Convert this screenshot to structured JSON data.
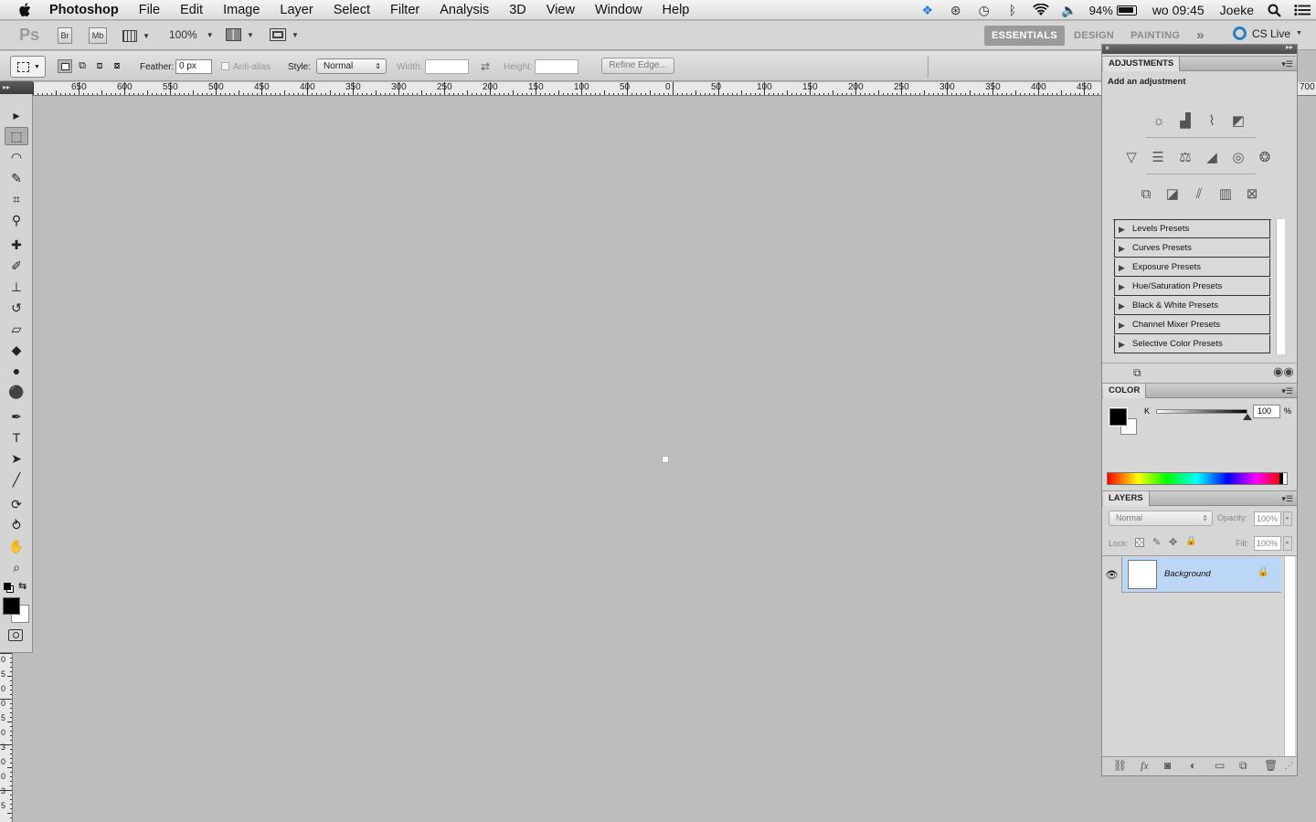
{
  "menubar": {
    "app_name": "Photoshop",
    "menus": [
      "File",
      "Edit",
      "Image",
      "Layer",
      "Select",
      "Filter",
      "Analysis",
      "3D",
      "View",
      "Window",
      "Help"
    ],
    "battery": "94%",
    "clock": "wo 09:45",
    "user": "Joeke"
  },
  "appbar": {
    "ps_logo": "Ps",
    "bridge": "Br",
    "mini_bridge": "Mb",
    "zoom": "100%",
    "workspaces": [
      "ESSENTIALS",
      "DESIGN",
      "PAINTING"
    ],
    "active_workspace": "ESSENTIALS",
    "more": "»",
    "cs_live": "CS Live"
  },
  "options": {
    "feather_label": "Feather:",
    "feather_value": "0 px",
    "antialias_label": "Anti-alias",
    "style_label": "Style:",
    "style_value": "Normal",
    "width_label": "Width:",
    "height_label": "Height:",
    "refine_edge": "Refine Edge..."
  },
  "rulers": {
    "h_ticks": [
      "650",
      "600",
      "550",
      "500",
      "450",
      "400",
      "350",
      "300",
      "250",
      "200",
      "150",
      "100",
      "50",
      "0",
      "50",
      "100",
      "150",
      "200",
      "250",
      "300",
      "350",
      "400",
      "450"
    ],
    "h_right": "700",
    "v_ticks": [
      "0",
      "5",
      "0",
      "0",
      "5",
      "0",
      "3",
      "0",
      "0",
      "3",
      "5"
    ]
  },
  "toolbox": {
    "tools": [
      {
        "name": "move",
        "glyph": "▸"
      },
      {
        "name": "marquee",
        "glyph": "⬚"
      },
      {
        "name": "lasso",
        "glyph": "◠"
      },
      {
        "name": "quick-select",
        "glyph": "✎"
      },
      {
        "name": "crop",
        "glyph": "⌗"
      },
      {
        "name": "eyedropper",
        "glyph": "⚲"
      },
      {
        "name": "healing",
        "glyph": "✚"
      },
      {
        "name": "brush",
        "glyph": "✐"
      },
      {
        "name": "stamp",
        "glyph": "⊥"
      },
      {
        "name": "history-brush",
        "glyph": "↺"
      },
      {
        "name": "eraser",
        "glyph": "▱"
      },
      {
        "name": "paint-bucket",
        "glyph": "◆"
      },
      {
        "name": "blur",
        "glyph": "●"
      },
      {
        "name": "dodge",
        "glyph": "⚫"
      },
      {
        "name": "pen",
        "glyph": "✒"
      },
      {
        "name": "type",
        "glyph": "T"
      },
      {
        "name": "path-select",
        "glyph": "➤"
      },
      {
        "name": "line",
        "glyph": "╱"
      },
      {
        "name": "3d-rotate",
        "glyph": "⟳"
      },
      {
        "name": "3d-orbit",
        "glyph": "⥁"
      },
      {
        "name": "hand",
        "glyph": "✋"
      },
      {
        "name": "zoom",
        "glyph": "⌕"
      }
    ],
    "selected_tool": "marquee",
    "foreground_color": "#000000",
    "background_color": "#ffffff"
  },
  "adjustments": {
    "title": "ADJUSTMENTS",
    "subtitle": "Add an adjustment",
    "presets": [
      "Levels Presets",
      "Curves Presets",
      "Exposure Presets",
      "Hue/Saturation Presets",
      "Black & White Presets",
      "Channel Mixer Presets",
      "Selective Color Presets"
    ]
  },
  "color": {
    "title": "COLOR",
    "channel": "K",
    "value": "100",
    "unit": "%",
    "level": 1.0
  },
  "layers": {
    "title": "LAYERS",
    "blend_mode": "Normal",
    "opacity_label": "Opacity:",
    "opacity_value": "100%",
    "lock_label": "Lock:",
    "fill_label": "Fill:",
    "fill_value": "100%",
    "items": [
      {
        "name": "Background",
        "visible": true,
        "locked": true,
        "selected": true
      }
    ],
    "selected_color": "#bcd7f5"
  }
}
